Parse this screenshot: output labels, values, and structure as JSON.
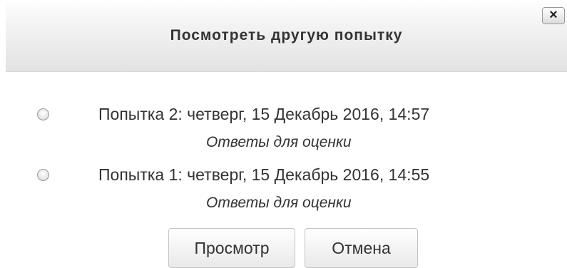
{
  "dialog": {
    "title": "Посмотреть другую попытку",
    "close_label": "×"
  },
  "attempts": [
    {
      "title": "Попытка 2: четверг, 15 Декабрь 2016, 14:57",
      "subtitle": "Ответы для оценки",
      "selected": false
    },
    {
      "title": "Попытка 1: четверг, 15 Декабрь 2016, 14:55",
      "subtitle": "Ответы для оценки",
      "selected": false
    }
  ],
  "buttons": {
    "view_label": "Просмотр",
    "cancel_label": "Отмена"
  }
}
